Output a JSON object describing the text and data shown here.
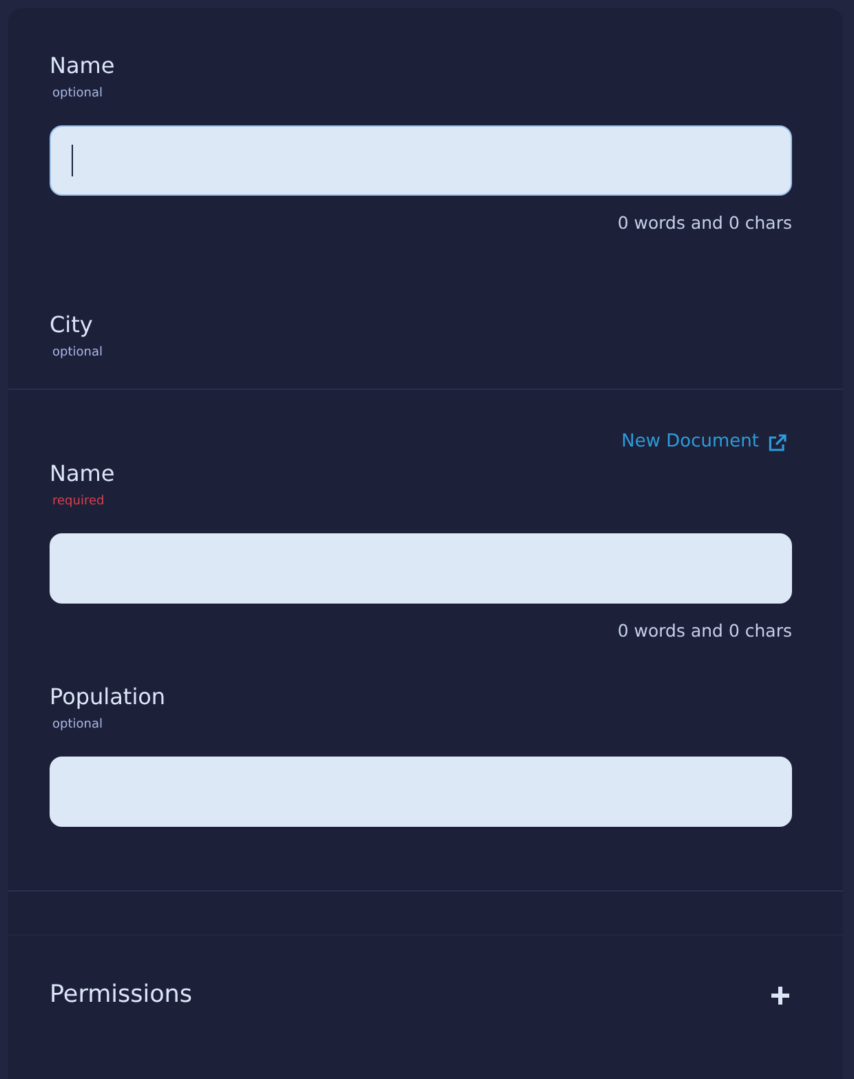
{
  "fields": [
    {
      "kind": "text",
      "label": "Name",
      "hint": "optional",
      "required": false,
      "focused": true,
      "counter": "0 words and 0 chars"
    },
    {
      "kind": "group",
      "label": "City",
      "hint": "optional",
      "required": false,
      "link": {
        "label": "New Document"
      },
      "fields": [
        {
          "kind": "text",
          "label": "Name",
          "hint": "required",
          "required": true,
          "focused": false,
          "counter": "0 words and 0 chars"
        },
        {
          "kind": "number",
          "label": "Population",
          "hint": "optional",
          "required": false,
          "focused": false
        }
      ]
    }
  ],
  "panel": {
    "title": "Permissions",
    "expanded": false
  }
}
